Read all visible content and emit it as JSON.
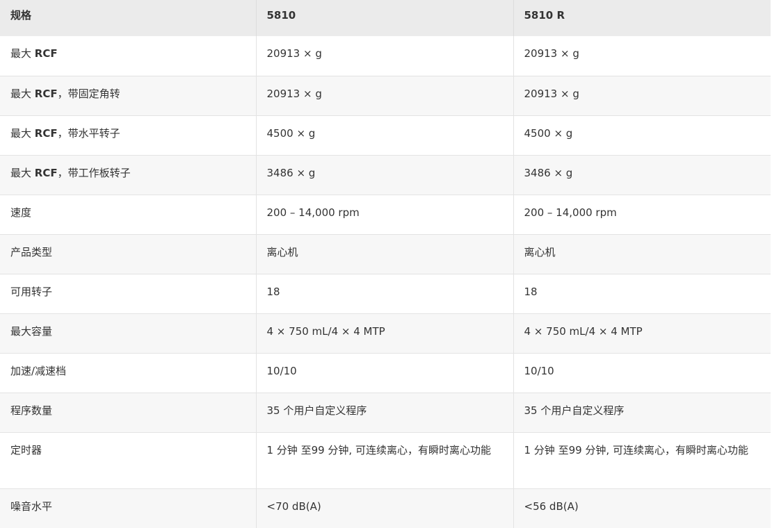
{
  "table": {
    "headers": [
      "规格",
      "5810",
      "5810 R"
    ],
    "rows": [
      {
        "label_prefix": "最大 ",
        "label_bold": "RCF",
        "label_suffix": "",
        "v1": "20913 × g",
        "v2": "20913 × g"
      },
      {
        "label_prefix": "最大 ",
        "label_bold": "RCF",
        "label_suffix": "，带固定角转",
        "v1": "20913 × g",
        "v2": "20913 × g"
      },
      {
        "label_prefix": "最大 ",
        "label_bold": "RCF",
        "label_suffix": "，带水平转子",
        "v1": "4500 × g",
        "v2": "4500 × g"
      },
      {
        "label_prefix": "最大 ",
        "label_bold": "RCF",
        "label_suffix": "，带工作板转子",
        "v1": "3486 × g",
        "v2": "3486 × g"
      },
      {
        "label_prefix": "速度",
        "label_bold": "",
        "label_suffix": "",
        "v1": "200 – 14,000 rpm",
        "v2": "200 – 14,000 rpm"
      },
      {
        "label_prefix": "产品类型",
        "label_bold": "",
        "label_suffix": "",
        "v1": "离心机",
        "v2": "离心机"
      },
      {
        "label_prefix": "可用转子",
        "label_bold": "",
        "label_suffix": "",
        "v1": "18",
        "v2": "18"
      },
      {
        "label_prefix": "最大容量",
        "label_bold": "",
        "label_suffix": "",
        "v1": "4 × 750 mL/4 × 4 MTP",
        "v2": "4 × 750 mL/4 × 4 MTP"
      },
      {
        "label_prefix": "加速/减速档",
        "label_bold": "",
        "label_suffix": "",
        "v1": "10/10",
        "v2": "10/10"
      },
      {
        "label_prefix": "程序数量",
        "label_bold": "",
        "label_suffix": "",
        "v1": "35 个用户自定义程序",
        "v2": "35 个用户自定义程序"
      },
      {
        "label_prefix": "定时器",
        "label_bold": "",
        "label_suffix": "",
        "v1": "1 分钟 至99 分钟, 可连续离心，有瞬时离心功能",
        "v2": "1 分钟 至99 分钟, 可连续离心，有瞬时离心功能"
      },
      {
        "label_prefix": "噪音水平",
        "label_bold": "",
        "label_suffix": "",
        "v1": "<70 dB(A)",
        "v2": "<56 dB(A)"
      }
    ]
  }
}
